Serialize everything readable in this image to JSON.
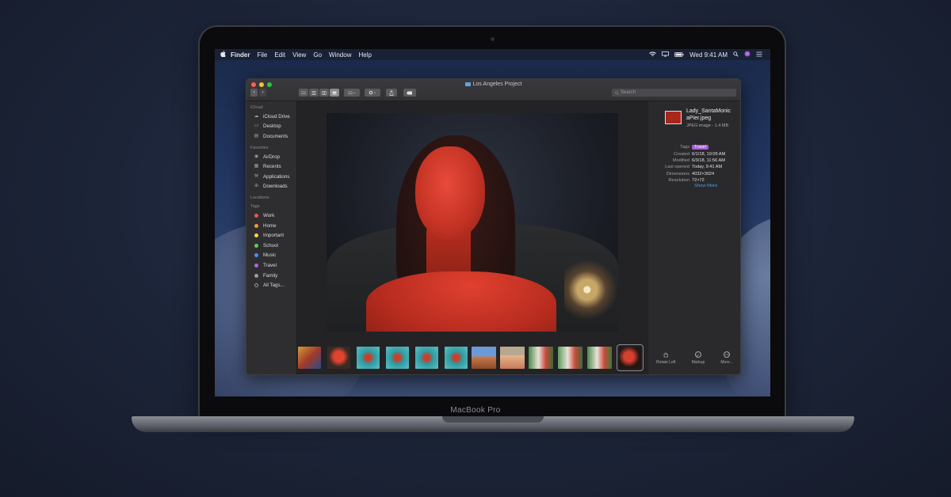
{
  "device": {
    "brand": "MacBook Pro"
  },
  "menubar": {
    "apple": "",
    "app": "Finder",
    "menus": [
      "File",
      "Edit",
      "View",
      "Go",
      "Window",
      "Help"
    ],
    "clock": "Wed 9:41 AM"
  },
  "window": {
    "title": "Los Angeles Project",
    "search_placeholder": "Search"
  },
  "sidebar": {
    "sections": {
      "icloud": "iCloud",
      "favorites": "Favorites",
      "locations": "Locations",
      "tags": "Tags"
    },
    "icloud_items": [
      "iCloud Drive",
      "Desktop",
      "Documents"
    ],
    "favorite_items": [
      "AirDrop",
      "Recents",
      "Applications",
      "Downloads"
    ],
    "tag_items": [
      {
        "label": "Work",
        "color": "#e8574d"
      },
      {
        "label": "Home",
        "color": "#f0993a"
      },
      {
        "label": "Important",
        "color": "#f2d64b"
      },
      {
        "label": "School",
        "color": "#5ed05a"
      },
      {
        "label": "Music",
        "color": "#4a8ff0"
      },
      {
        "label": "Travel",
        "color": "#b064e0"
      },
      {
        "label": "Family",
        "color": "#9a9aa0"
      },
      {
        "label": "All Tags...",
        "color": ""
      }
    ]
  },
  "inspector": {
    "file_name_line1": "Lady_SantaMonic",
    "file_name_line2": "aPier.jpeg",
    "kind": "JPEG image - 1.4 MB",
    "tags_label": "Tags",
    "tag": "Travel",
    "rows": [
      {
        "key": "Created",
        "value": "6/1/18, 10:09 AM"
      },
      {
        "key": "Modified",
        "value": "6/3/18, 11:56 AM"
      },
      {
        "key": "Last opened",
        "value": "Today, 9:41 AM"
      },
      {
        "key": "Dimensions",
        "value": "4032×3024"
      },
      {
        "key": "Resolution",
        "value": "72×72"
      }
    ],
    "show_more": "Show More",
    "actions": [
      "Rotate Left",
      "Markup",
      "More..."
    ]
  }
}
